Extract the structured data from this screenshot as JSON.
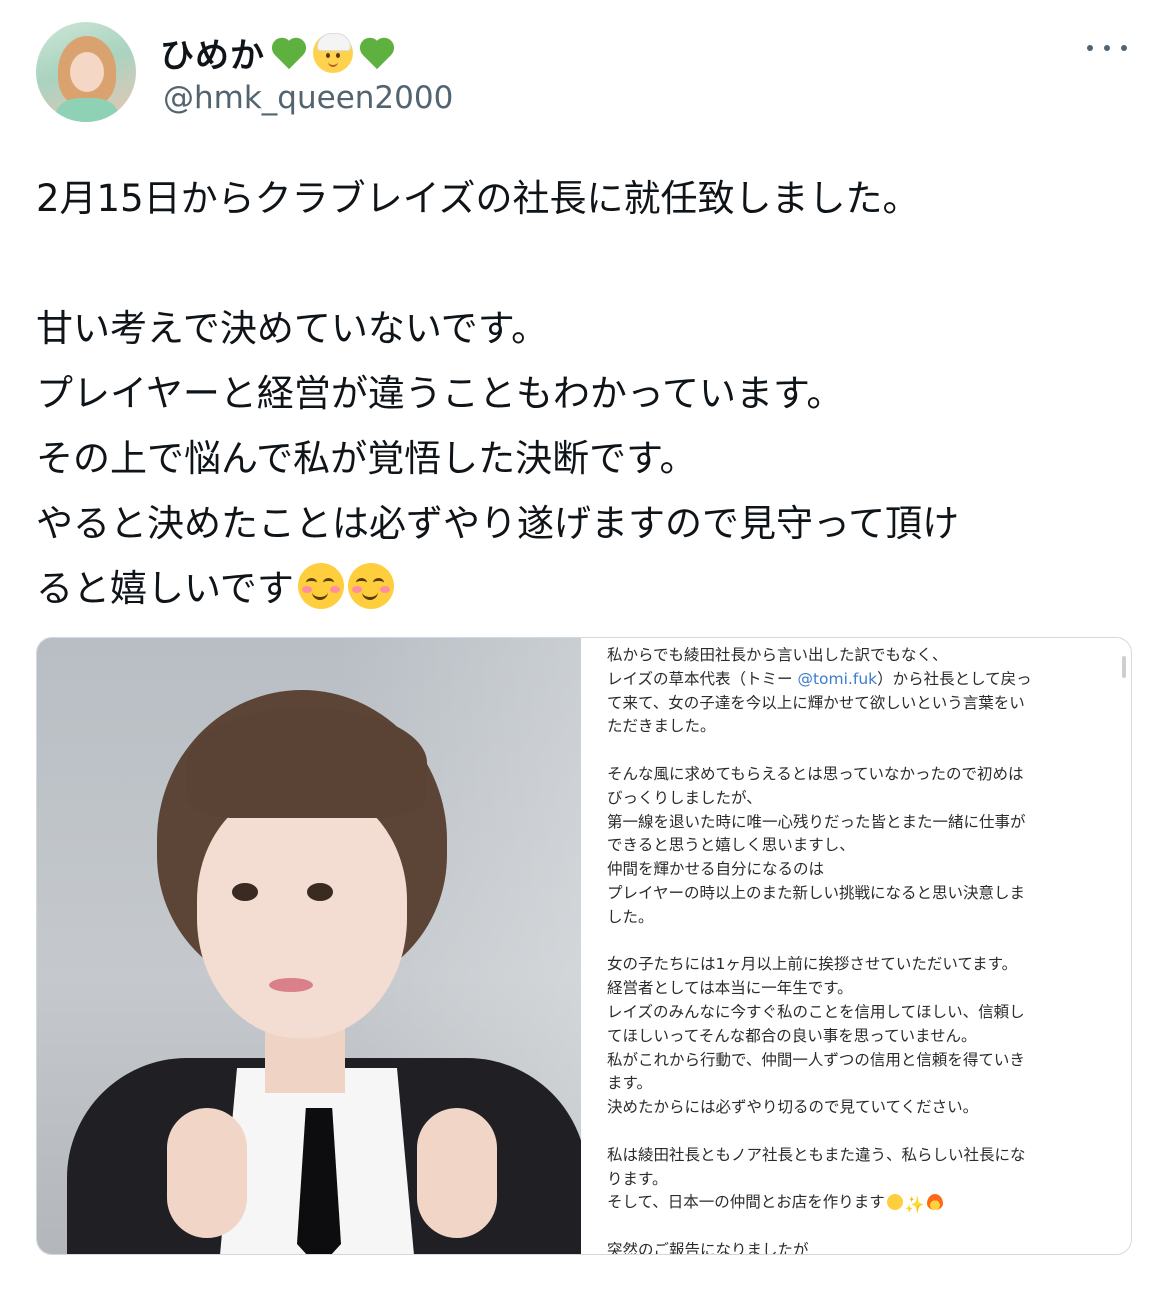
{
  "user": {
    "display_name": "ひめか",
    "handle": "@hmk_queen2000",
    "name_emojis": [
      "green-heart-icon",
      "bride-with-veil-icon",
      "green-heart-icon"
    ]
  },
  "tweet": {
    "lines": [
      "2月15日からクラブレイズの社長に就任致しました。",
      "",
      "甘い考えで決めていないです。",
      "プレイヤーと経営が違うこともわかっています。",
      "その上で悩んで私が覚悟した決断です。",
      "やると決めたことは必ずやり遂げますので見守って頂け",
      "ると嬉しいです"
    ],
    "trailing_emojis": [
      "smiling-face-with-smiling-eyes-icon",
      "smiling-face-with-smiling-eyes-icon"
    ]
  },
  "media": {
    "note_lines": [
      "私からでも綾田社長から言い出した訳でもなく、",
      "レイズの草本代表（トミー ",
      "て来て、女の子達を今以上に輝かせて欲しいという言葉をい",
      "ただきました。",
      "",
      "そんな風に求めてもらえるとは思っていなかったので初めは",
      "びっくりしましたが、",
      "第一線を退いた時に唯一心残りだった皆とまた一緒に仕事が",
      "できると思うと嬉しく思いますし、",
      "仲間を輝かせる自分になるのは",
      "プレイヤーの時以上のまた新しい挑戦になると思い決意しま",
      "した。",
      "",
      "女の子たちには1ヶ月以上前に挨拶させていただいてます。",
      "経営者としては本当に一年生です。",
      "レイズのみんなに今すぐ私のことを信用してほしい、信頼し",
      "てほしいってそんな都合の良い事を思っていません。",
      "私がこれから行動で、仲間一人ずつの信用と信頼を得ていき",
      "ます。",
      "決めたからには必ずやり切るので見ていてください。",
      "",
      "私は綾田社長ともノア社長ともまた違う、私らしい社長にな",
      "ります。",
      "そして、日本一の仲間とお店を作ります",
      "",
      "突然のご報告になりましたが"
    ],
    "mention": "@tomi.fuk",
    "mention_suffix": "）から社長として戻っ",
    "note_trailing_emojis": [
      "smiling-face-icon",
      "sparkles-icon",
      "fire-icon"
    ]
  }
}
